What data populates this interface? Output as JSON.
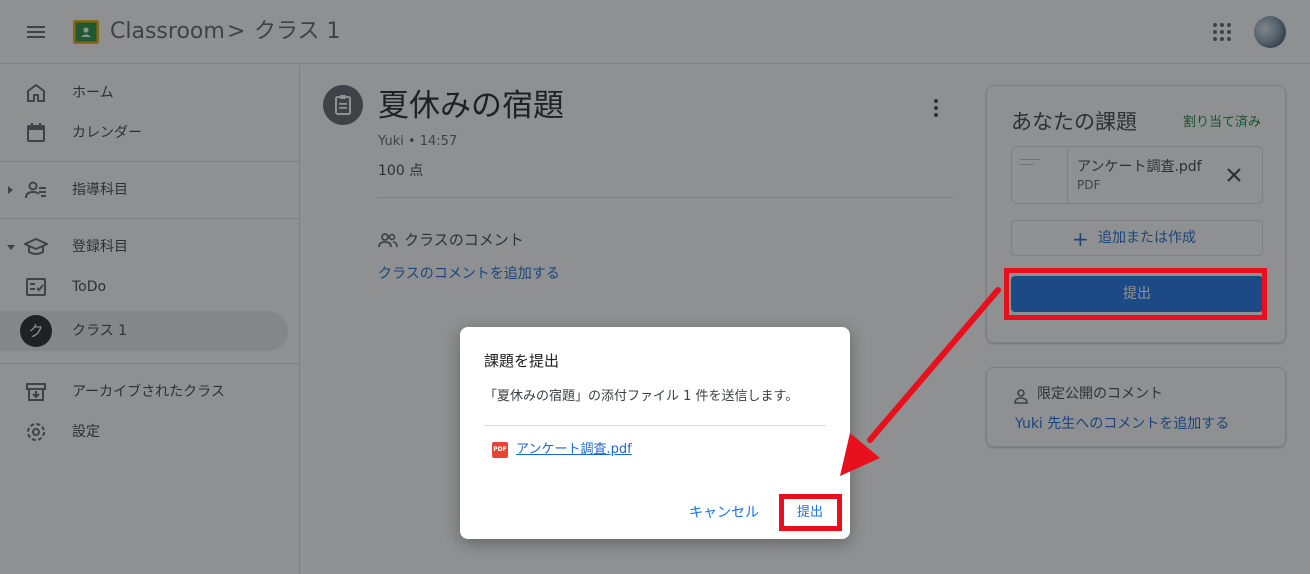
{
  "header": {
    "app_title": "Classroom",
    "separator": ">",
    "class_name": "クラス 1"
  },
  "sidebar": {
    "items": [
      {
        "label": "ホーム"
      },
      {
        "label": "カレンダー"
      },
      {
        "label": "指導科目"
      },
      {
        "label": "登録科目"
      },
      {
        "label": "ToDo"
      },
      {
        "label": "クラス 1",
        "avatar_letter": "ク"
      },
      {
        "label": "アーカイブされたクラス"
      },
      {
        "label": "設定"
      }
    ]
  },
  "assignment": {
    "title": "夏休みの宿題",
    "meta": "Yuki • 14:57",
    "points": "100 点",
    "class_comments_label": "クラスのコメント",
    "add_class_comment": "クラスのコメントを追加する"
  },
  "your_work": {
    "title": "あなたの課題",
    "status": "割り当て済み",
    "status_color": "#188038",
    "attachment": {
      "name": "アンケート調査.pdf",
      "type": "PDF"
    },
    "add_create_label": "追加または作成",
    "turn_in_label": "提出"
  },
  "private_comments": {
    "label": "限定公開のコメント",
    "add_link": "Yuki 先生へのコメントを追加する"
  },
  "dialog": {
    "title": "課題を提出",
    "body": "「夏休みの宿題」の添付ファイル 1 件を送信します。",
    "file_icon": "PDF",
    "file_name": "アンケート調査.pdf",
    "cancel_label": "キャンセル",
    "submit_label": "提出"
  },
  "colors": {
    "accent": "#1a73e8",
    "link": "#1967d2",
    "highlight": "#e8101d"
  }
}
